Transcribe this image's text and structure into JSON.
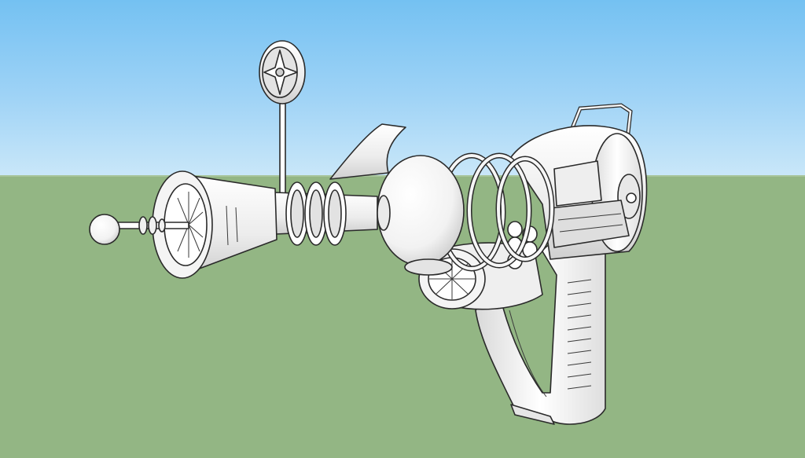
{
  "scene": {
    "sky_color": "#8ccaf4",
    "ground_color": "#93b684",
    "model_fill": "#f2f2f2",
    "model_shade": "#d7d7d7",
    "edge_color": "#2a2a2a"
  }
}
